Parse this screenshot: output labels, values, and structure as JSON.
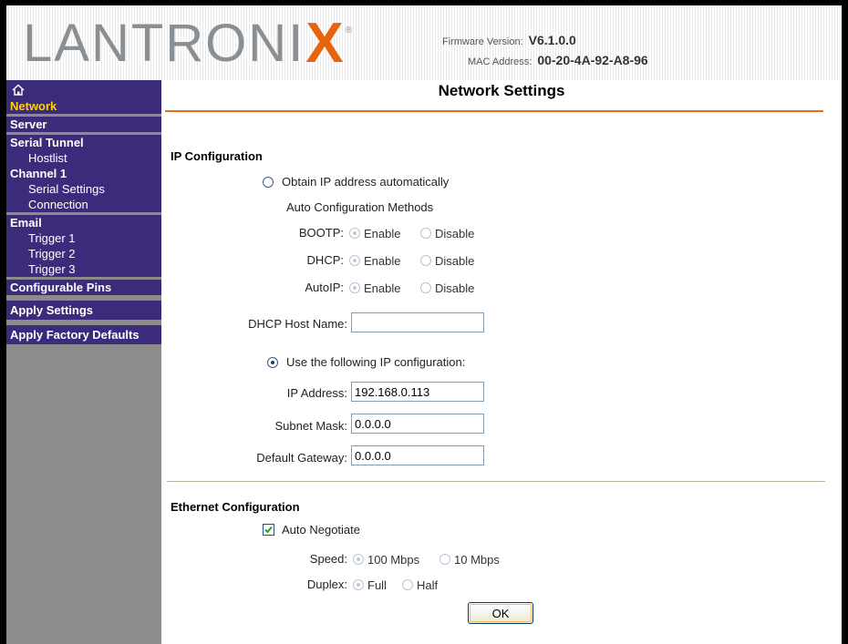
{
  "header": {
    "logo_text": "LANTRONIX",
    "firmware_label": "Firmware Version:",
    "firmware_value": "V6.1.0.0",
    "mac_label": "MAC Address:",
    "mac_value": "00-20-4A-92-A8-96"
  },
  "sidebar": {
    "home_icon": "home-icon",
    "items": [
      {
        "label": "Network",
        "active": true
      },
      {
        "label": "Server"
      },
      {
        "label": "Serial Tunnel"
      },
      {
        "label": "Hostlist"
      },
      {
        "label": "Channel 1"
      },
      {
        "label": "Serial Settings"
      },
      {
        "label": "Connection"
      },
      {
        "label": "Email"
      },
      {
        "label": "Trigger 1"
      },
      {
        "label": "Trigger 2"
      },
      {
        "label": "Trigger 3"
      },
      {
        "label": "Configurable Pins"
      },
      {
        "label": "Apply Settings"
      },
      {
        "label": "Apply Factory Defaults"
      }
    ]
  },
  "main": {
    "title": "Network Settings",
    "ip_config": {
      "heading": "IP Configuration",
      "obtain_auto": "Obtain IP address automatically",
      "auto_methods": "Auto Configuration Methods",
      "bootp_label": "BOOTP:",
      "dhcp_label": "DHCP:",
      "autoip_label": "AutoIP:",
      "enable": "Enable",
      "disable": "Disable",
      "host_name_label": "DHCP Host Name:",
      "host_name_value": "",
      "use_following": "Use the following IP configuration:",
      "ip_label": "IP Address:",
      "ip_value": "192.168.0.113",
      "subnet_label": "Subnet Mask:",
      "subnet_value": "0.0.0.0",
      "gateway_label": "Default Gateway:",
      "gateway_value": "0.0.0.0"
    },
    "ethernet": {
      "heading": "Ethernet Configuration",
      "auto_negotiate": "Auto Negotiate",
      "auto_negotiate_checked": true,
      "speed_label": "Speed:",
      "speed_100": "100 Mbps",
      "speed_10": "10 Mbps",
      "duplex_label": "Duplex:",
      "duplex_full": "Full",
      "duplex_half": "Half"
    },
    "ok_label": "OK"
  },
  "colors": {
    "sidebar_bg": "#3b2b7a",
    "sidebar_active": "#ffd200",
    "accent_line": "#e07020",
    "logo_x": "#e8640e"
  }
}
